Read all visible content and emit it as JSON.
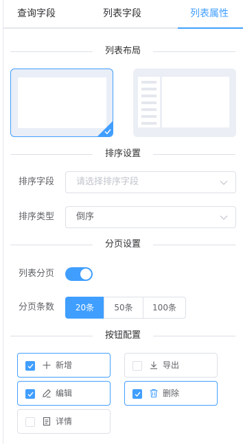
{
  "tabs": [
    {
      "label": "查询字段",
      "active": false
    },
    {
      "label": "列表字段",
      "active": false
    },
    {
      "label": "列表属性",
      "active": true
    }
  ],
  "sections": {
    "layout": "列表布局",
    "sort": "排序设置",
    "paging": "分页设置",
    "buttons": "按钮配置"
  },
  "layout_options": [
    {
      "name": "full-list",
      "selected": true
    },
    {
      "name": "tree-list",
      "selected": false
    }
  ],
  "sort": {
    "field_label": "排序字段",
    "field_placeholder": "请选择排序字段",
    "field_value": "",
    "type_label": "排序类型",
    "type_value": "倒序"
  },
  "paging": {
    "enabled_label": "列表分页",
    "enabled": true,
    "size_label": "分页条数",
    "sizes": [
      "20条",
      "50条",
      "100条"
    ],
    "selected_size": "20条"
  },
  "buttons": [
    {
      "label": "新增",
      "icon": "plus-icon",
      "checked": true
    },
    {
      "label": "导出",
      "icon": "download-icon",
      "checked": false
    },
    {
      "label": "编辑",
      "icon": "edit-icon",
      "checked": true
    },
    {
      "label": "删除",
      "icon": "delete-icon",
      "checked": true
    },
    {
      "label": "详情",
      "icon": "document-icon",
      "checked": false
    }
  ],
  "colors": {
    "primary": "#409eff",
    "border": "#dcdfe6",
    "text": "#606266"
  }
}
